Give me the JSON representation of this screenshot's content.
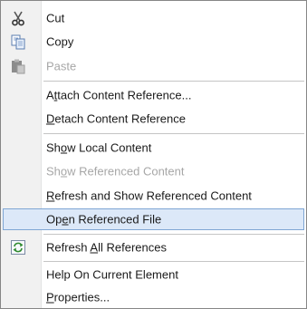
{
  "menu": {
    "items": [
      {
        "key": "cut",
        "pre": "",
        "u": "",
        "post": "Cut",
        "icon": "scissors-icon",
        "disabled": false
      },
      {
        "key": "copy",
        "pre": "",
        "u": "",
        "post": "Copy",
        "icon": "copy-icon",
        "disabled": false
      },
      {
        "key": "paste",
        "pre": "",
        "u": "",
        "post": "Paste",
        "icon": "paste-icon",
        "disabled": true
      },
      {
        "key": "attach",
        "pre": "A",
        "u": "t",
        "post": "tach Content Reference...",
        "disabled": false
      },
      {
        "key": "detach",
        "pre": "",
        "u": "D",
        "post": "etach Content Reference",
        "disabled": false
      },
      {
        "key": "show-local",
        "pre": "Sh",
        "u": "o",
        "post": "w Local Content",
        "disabled": false
      },
      {
        "key": "show-referenced",
        "pre": "Sh",
        "u": "o",
        "post": "w Referenced Content",
        "disabled": true
      },
      {
        "key": "refresh-show",
        "pre": "",
        "u": "R",
        "post": "efresh and Show Referenced Content",
        "disabled": false
      },
      {
        "key": "open-referenced",
        "pre": "Op",
        "u": "e",
        "post": "n Referenced File",
        "disabled": false,
        "highlighted": true
      },
      {
        "key": "refresh-all",
        "pre": "Refresh ",
        "u": "A",
        "post": "ll References",
        "icon": "refresh-icon",
        "disabled": false
      },
      {
        "key": "help-current",
        "pre": "Help On Current Element",
        "u": "",
        "post": "",
        "disabled": false
      },
      {
        "key": "properties",
        "pre": "",
        "u": "P",
        "post": "roperties...",
        "disabled": false
      }
    ]
  },
  "colors": {
    "highlight_bg": "#dce8f8",
    "highlight_border": "#7fa6d4",
    "disabled_text": "#a7a7a7"
  }
}
